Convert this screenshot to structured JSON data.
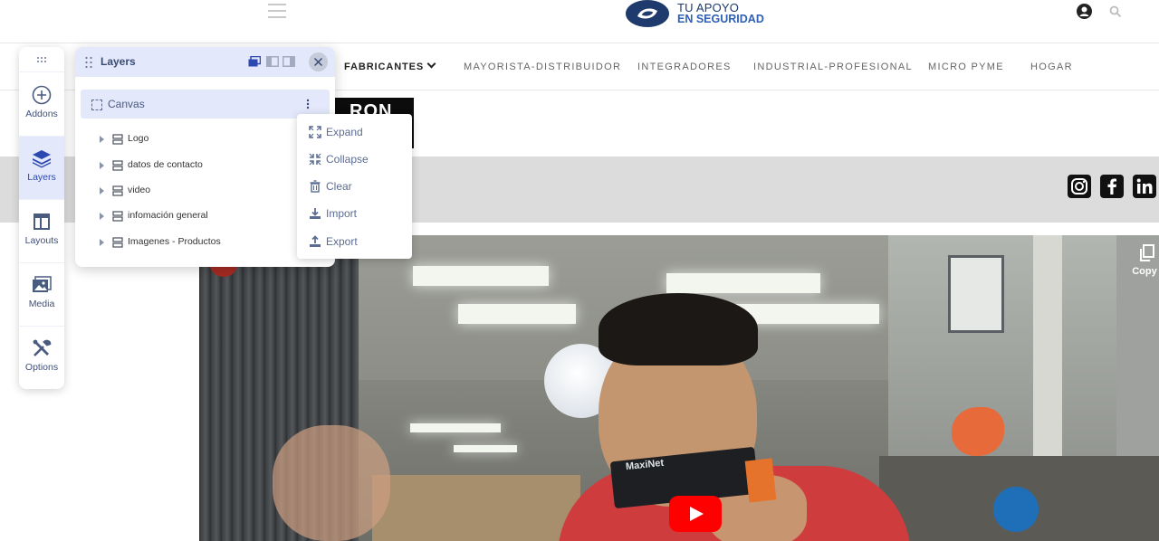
{
  "site": {
    "logo": {
      "line1": "TU APOYO",
      "line2": "EN SEGURIDAD"
    },
    "nav": [
      {
        "label": "FABRICANTES",
        "active": true
      },
      {
        "label": "MAYORISTA-DISTRIBUIDOR"
      },
      {
        "label": "INTEGRADORES"
      },
      {
        "label": "INDUSTRIAL-PROFESIONAL"
      },
      {
        "label": "MICRO PYME"
      },
      {
        "label": "HOGAR"
      }
    ],
    "brand_fragment": "RON",
    "social_icons": [
      "instagram-icon",
      "facebook-icon",
      "linkedin-icon"
    ]
  },
  "video": {
    "product_text": "MaxiNet",
    "copy_label": "Copy l",
    "play_icon": "youtube-play-icon"
  },
  "rail": {
    "items": [
      {
        "label": "Addons",
        "icon": "plus-circle-icon"
      },
      {
        "label": "Layers",
        "icon": "layers-icon",
        "active": true
      },
      {
        "label": "Layouts",
        "icon": "layout-icon"
      },
      {
        "label": "Media",
        "icon": "image-icon"
      },
      {
        "label": "Options",
        "icon": "wrench-icon"
      }
    ]
  },
  "layers_panel": {
    "title": "Layers",
    "canvas_label": "Canvas",
    "layers": [
      {
        "label": "Logo"
      },
      {
        "label": "datos de contacto"
      },
      {
        "label": "video"
      },
      {
        "label": "infomación general"
      },
      {
        "label": "Imagenes - Productos"
      }
    ]
  },
  "context_menu": {
    "items": [
      {
        "label": "Expand",
        "icon": "expand-icon"
      },
      {
        "label": "Collapse",
        "icon": "collapse-icon"
      },
      {
        "label": "Clear",
        "icon": "trash-icon"
      },
      {
        "label": "Import",
        "icon": "download-icon"
      },
      {
        "label": "Export",
        "icon": "upload-icon"
      }
    ]
  },
  "colors": {
    "accent": "#2b49b0",
    "panel_header": "#e3e8fb",
    "logo_dark": "#1f3a6d",
    "logo_blue": "#2f60b5"
  }
}
